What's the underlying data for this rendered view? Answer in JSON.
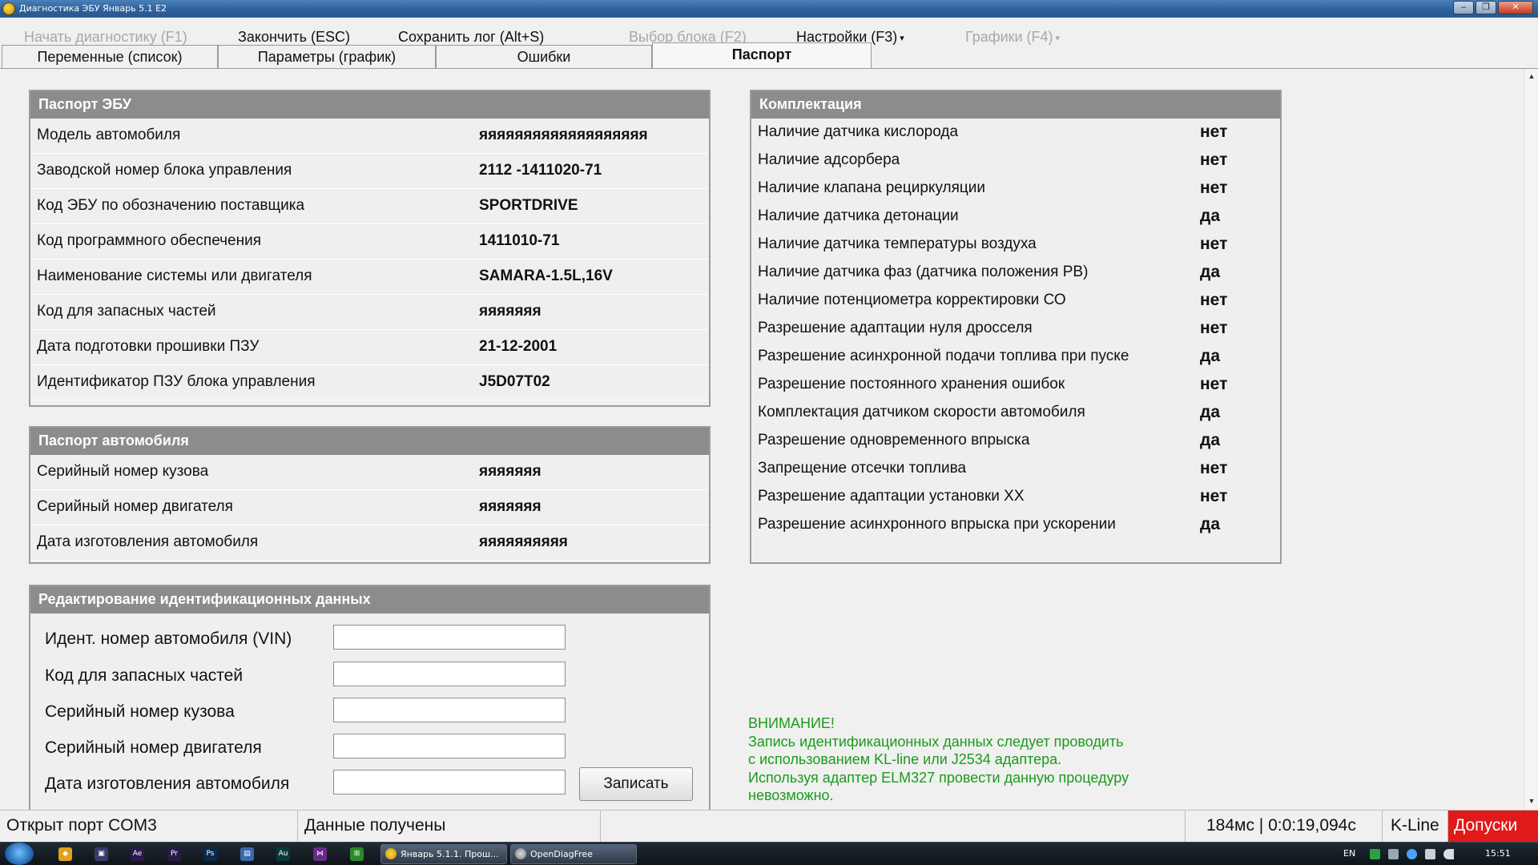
{
  "window": {
    "title": "Диагностика ЭБУ Январь 5.1 E2",
    "buttons": [
      "–",
      "❐",
      "✕"
    ]
  },
  "menu": [
    {
      "label": "Начать диагностику (F1)",
      "enabled": false
    },
    {
      "label": "Закончить (ESC)",
      "enabled": true
    },
    {
      "label": "Сохранить лог (Alt+S)",
      "enabled": true
    },
    {
      "label": "Выбор блока (F2)",
      "enabled": false
    },
    {
      "label": "Настройки (F3)",
      "enabled": true,
      "dropdown": true
    },
    {
      "label": "Графики (F4)",
      "enabled": false,
      "dropdown": true
    }
  ],
  "tabs": [
    {
      "label": "Переменные (список)",
      "active": false
    },
    {
      "label": "Параметры (график)",
      "active": false
    },
    {
      "label": "Ошибки",
      "active": false
    },
    {
      "label": "Паспорт",
      "active": true
    }
  ],
  "ecu_passport": {
    "title": "Паспорт ЭБУ",
    "rows": [
      {
        "label": "Модель автомобиля",
        "value": "яяяяяяяяяяяяяяяяяяя"
      },
      {
        "label": "Заводской номер блока управления",
        "value": "2112 -1411020-71"
      },
      {
        "label": "Код ЭБУ по обозначению поставщика",
        "value": "SPORTDRIVE"
      },
      {
        "label": "Код программного обеспечения",
        "value": "1411010-71"
      },
      {
        "label": "Наименование системы или двигателя",
        "value": "SAMARA-1.5L,16V"
      },
      {
        "label": "Код для запасных частей",
        "value": "яяяяяяя"
      },
      {
        "label": "Дата подготовки прошивки ПЗУ",
        "value": "21-12-2001"
      },
      {
        "label": "Идентификатор ПЗУ блока управления",
        "value": "J5D07T02"
      }
    ]
  },
  "car_passport": {
    "title": "Паспорт автомобиля",
    "rows": [
      {
        "label": "Серийный номер кузова",
        "value": "яяяяяяя"
      },
      {
        "label": "Серийный номер двигателя",
        "value": "яяяяяяя"
      },
      {
        "label": "Дата изготовления автомобиля",
        "value": "яяяяяяяяяя"
      }
    ]
  },
  "edit_panel": {
    "title": "Редактирование идентификационных данных",
    "fields": [
      {
        "label": "Идент. номер автомобиля (VIN)",
        "value": ""
      },
      {
        "label": "Код для запасных частей",
        "value": ""
      },
      {
        "label": "Серийный номер кузова",
        "value": ""
      },
      {
        "label": "Серийный номер двигателя",
        "value": ""
      },
      {
        "label": "Дата изготовления автомобиля",
        "value": ""
      }
    ],
    "save_label": "Записать"
  },
  "equipment": {
    "title": "Комплектация",
    "rows": [
      {
        "label": "Наличие датчика кислорода",
        "value": "нет"
      },
      {
        "label": "Наличие адсорбера",
        "value": "нет"
      },
      {
        "label": "Наличие клапана рециркуляции",
        "value": "нет"
      },
      {
        "label": "Наличие датчика детонации",
        "value": "да"
      },
      {
        "label": "Наличие датчика температуры воздуха",
        "value": "нет"
      },
      {
        "label": "Наличие датчика фаз (датчика положения РВ)",
        "value": "да"
      },
      {
        "label": "Наличие потенциометра корректировки СО",
        "value": "нет"
      },
      {
        "label": "Разрешение адаптации нуля дросселя",
        "value": "нет"
      },
      {
        "label": "Разрешение асинхронной подачи топлива при пуске",
        "value": "да"
      },
      {
        "label": "Разрешение постоянного хранения ошибок",
        "value": "нет"
      },
      {
        "label": "Комплектация датчиком скорости автомобиля",
        "value": "да"
      },
      {
        "label": "Разрешение одновременного впрыска",
        "value": "да"
      },
      {
        "label": "Запрещение отсечки топлива",
        "value": "нет"
      },
      {
        "label": "Разрешение адаптации установки XX",
        "value": "нет"
      },
      {
        "label": "Разрешение асинхронного впрыска при ускорении",
        "value": "да"
      }
    ]
  },
  "warning": {
    "title": "ВНИМАНИЕ!",
    "lines": [
      "Запись идентификационных данных следует проводить",
      "с использованием KL-line или J2534 адаптера.",
      "Используя адаптер ELM327 провести данную процедуру",
      "невозможно."
    ],
    "color": "#1b9b1b"
  },
  "status": {
    "port": "Открыт порт COM3",
    "data": "Данные получены",
    "timing": "184мс | 0:0:19,094с",
    "protocol": "K-Line",
    "alert": "Допуски",
    "alert_color": "#e01a1a"
  },
  "taskbar": {
    "tasks": [
      "Январь 5.1.1. Прош...",
      "OpenDiagFree"
    ],
    "lang": "EN",
    "clock": "15:51"
  }
}
